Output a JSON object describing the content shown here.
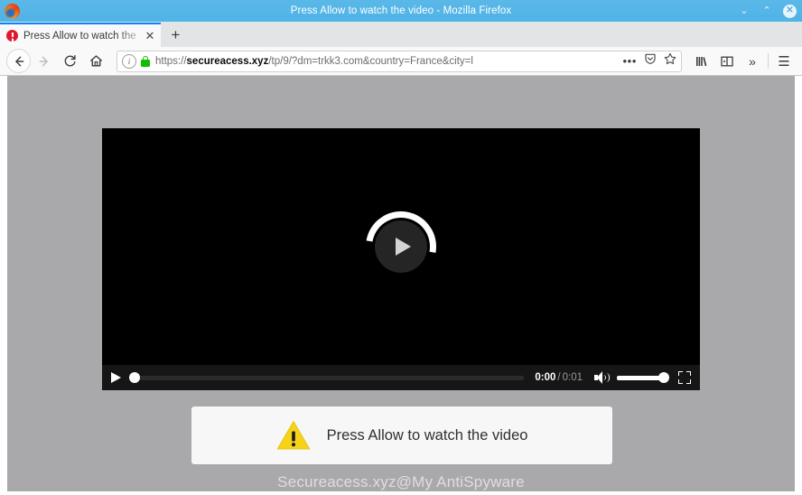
{
  "window": {
    "title": "Press Allow to watch the video - Mozilla Firefox",
    "logo_icon": "firefox-logo-icon",
    "minimize_label": "⌄",
    "maximize_label": "⌃",
    "close_label": "✕"
  },
  "tabs": {
    "items": [
      {
        "title": "Press Allow to watch the",
        "favicon": "red-alert-favicon",
        "close_label": "✕"
      }
    ],
    "new_tab_label": "+"
  },
  "toolbar": {
    "back_label": "←",
    "forward_label": "→",
    "reload_label": "↻",
    "home_label": "home-icon",
    "identity_icon": "info-icon",
    "lock_icon": "padlock-icon",
    "url": {
      "scheme": "https://",
      "host": "secureacess.xyz",
      "path": "/tp/9/?dm=trkk3.com&country=France&city=l"
    },
    "page_actions_label": "•••",
    "pocket_icon": "pocket-shield-icon",
    "bookmark_icon": "star-icon",
    "library_icon": "library-icon",
    "sidebar_icon": "sidebar-icon",
    "overflow_label": "»",
    "menu_label": "☰"
  },
  "page": {
    "background_color": "#a9a9ab",
    "video": {
      "play_overlay_icon": "play-triangle-icon",
      "loading_icon": "loading-spinner-icon",
      "controls": {
        "play_label": "play-icon",
        "current_time": "0:00",
        "separator": "/",
        "duration": "0:01",
        "volume_icon": "volume-icon",
        "fullscreen_icon": "fullscreen-icon"
      }
    },
    "notification": {
      "icon": "warning-triangle-icon",
      "icon_color": "#f6d319",
      "message": "Press Allow to watch the video"
    },
    "watermark": "Secureacess.xyz@My AntiSpyware"
  }
}
